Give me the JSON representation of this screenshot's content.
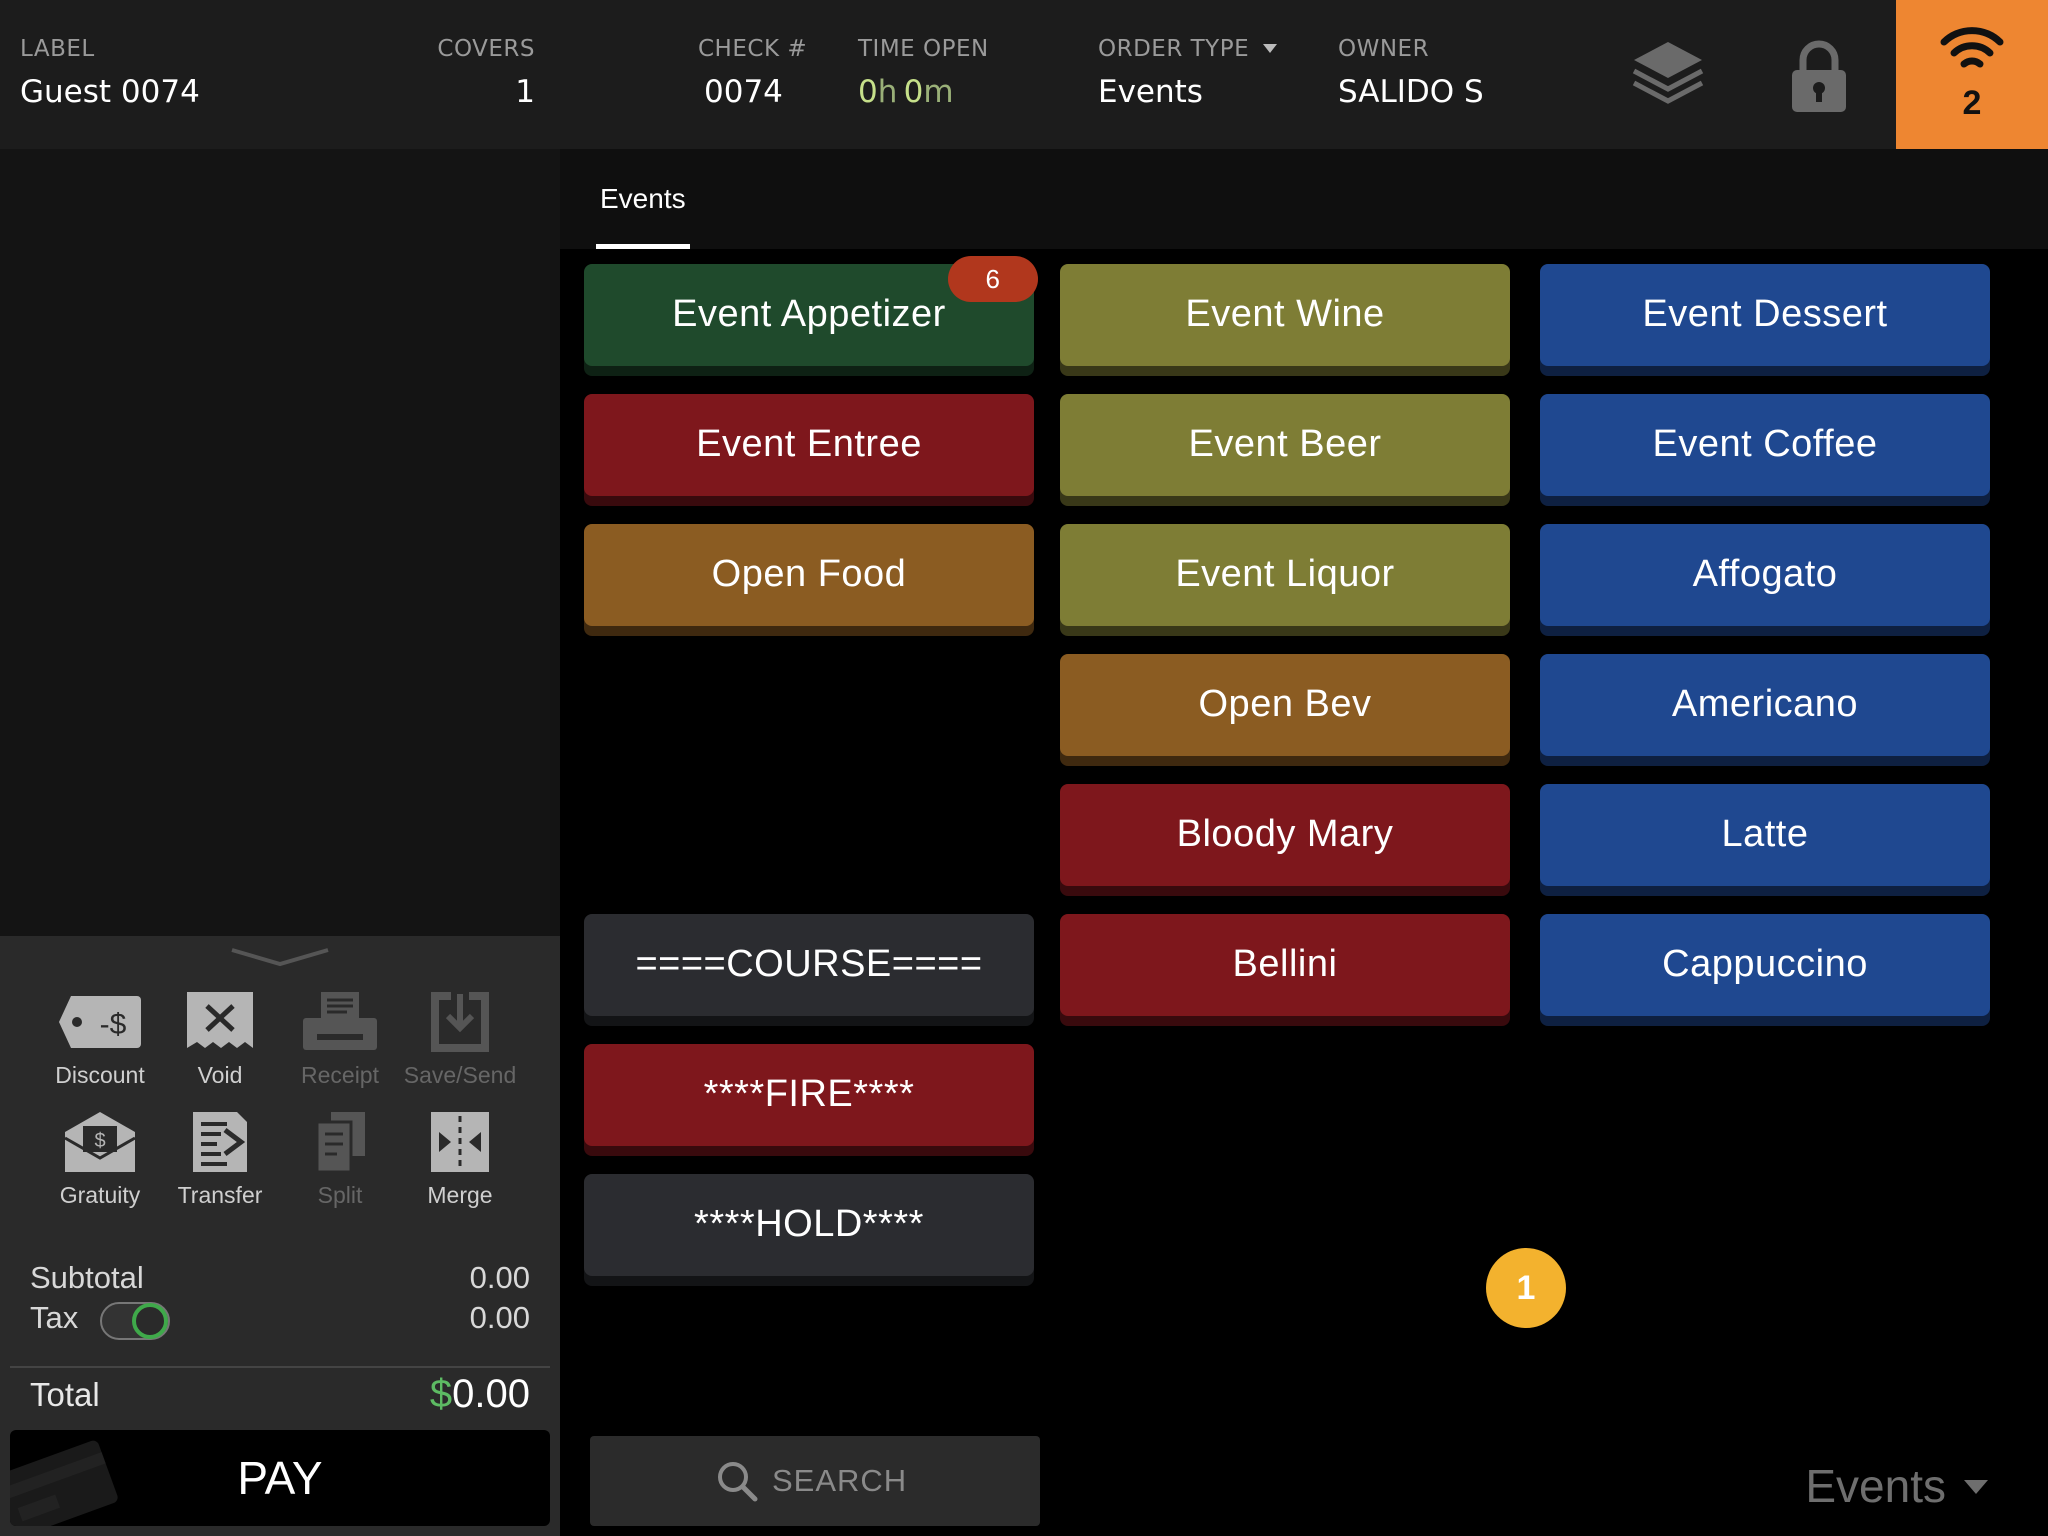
{
  "header": {
    "label": {
      "title": "LABEL",
      "value": "Guest 0074"
    },
    "covers": {
      "title": "COVERS",
      "value": "1"
    },
    "check": {
      "title": "CHECK #",
      "value": "0074"
    },
    "time_open": {
      "title": "TIME OPEN",
      "hours": "0",
      "hours_unit": "h",
      "minutes": "0",
      "minutes_unit": "m"
    },
    "order_type": {
      "title": "ORDER TYPE",
      "value": "Events"
    },
    "owner": {
      "title": "OWNER",
      "value": "SALIDO S"
    },
    "icons": {
      "layers": "layers-icon",
      "lock": "lock-icon",
      "wifi": "wifi-icon"
    },
    "wifi_count": "2",
    "accent_color": "#ee8631"
  },
  "actions": [
    {
      "label": "Discount",
      "icon": "discount-tag-icon",
      "enabled": true
    },
    {
      "label": "Void",
      "icon": "void-receipt-icon",
      "enabled": true
    },
    {
      "label": "Receipt",
      "icon": "printer-icon",
      "enabled": false
    },
    {
      "label": "Save/Send",
      "icon": "save-send-icon",
      "enabled": false
    },
    {
      "label": "Gratuity",
      "icon": "gratuity-envelope-icon",
      "enabled": true
    },
    {
      "label": "Transfer",
      "icon": "transfer-icon",
      "enabled": true
    },
    {
      "label": "Split",
      "icon": "split-icon",
      "enabled": false
    },
    {
      "label": "Merge",
      "icon": "merge-icon",
      "enabled": true
    }
  ],
  "totals": {
    "subtotal_label": "Subtotal",
    "subtotal_value": "0.00",
    "tax_label": "Tax",
    "tax_value": "0.00",
    "tax_enabled": true,
    "total_label": "Total",
    "total_currency": "$",
    "total_value": "0.00"
  },
  "pay_label": "PAY",
  "tabs": [
    {
      "label": "Events",
      "active": true
    }
  ],
  "menu_buttons": [
    {
      "label": "Event Appetizer",
      "color": "#1f4a2c",
      "badge": "6"
    },
    {
      "label": "Event Wine",
      "color": "#7e7d35"
    },
    {
      "label": "Event Dessert",
      "color": "#1f4890"
    },
    {
      "label": "Event Entree",
      "color": "#7e171c"
    },
    {
      "label": "Event Beer",
      "color": "#7e7d35"
    },
    {
      "label": "Event Coffee",
      "color": "#1f4890"
    },
    {
      "label": "Open Food",
      "color": "#8b5c22"
    },
    {
      "label": "Event Liquor",
      "color": "#7e7d35"
    },
    {
      "label": "Affogato",
      "color": "#1f4890"
    },
    {
      "label": "Open Bev",
      "color": "#8b5c22"
    },
    {
      "label": "Americano",
      "color": "#1f4890"
    },
    {
      "label": "Bloody Mary",
      "color": "#7e171c"
    },
    {
      "label": "Latte",
      "color": "#1f4890"
    },
    {
      "label": "====COURSE====",
      "color": "#2b2c30"
    },
    {
      "label": "Bellini",
      "color": "#7e171c"
    },
    {
      "label": "Cappuccino",
      "color": "#1f4890"
    },
    {
      "label": "****FIRE****",
      "color": "#7e171c"
    },
    {
      "label": "****HOLD****",
      "color": "#2b2c30"
    }
  ],
  "search_placeholder": "SEARCH",
  "menu_selector": "Events",
  "page_indicator": "1"
}
